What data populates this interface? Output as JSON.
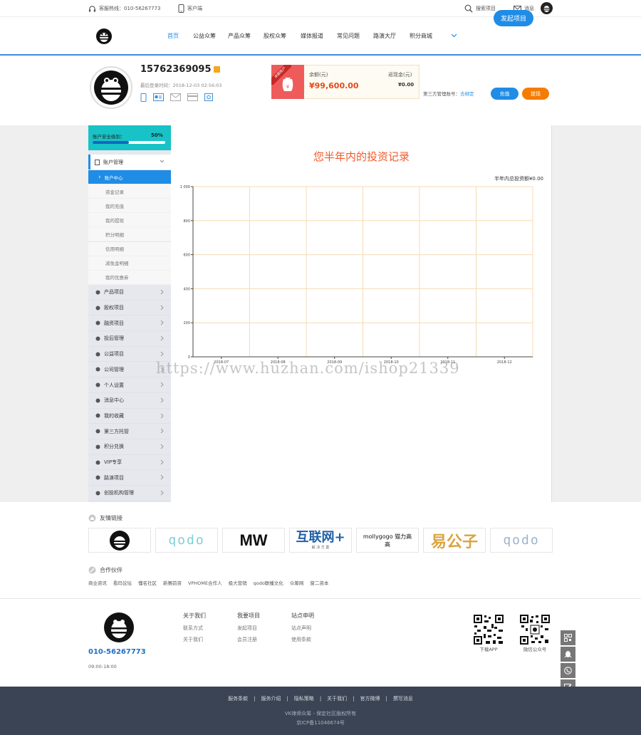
{
  "topbar": {
    "hotline": "客服热线：010-56267773",
    "app": "客户端",
    "search": "搜索项目",
    "message": "消息"
  },
  "nav": {
    "items": [
      "首页",
      "公益众筹",
      "产品众筹",
      "股权众筹",
      "媒体报道",
      "常见问题",
      "路演大厅",
      "积分商城"
    ],
    "launch": "发起项目"
  },
  "profile": {
    "phone": "15762369095",
    "login_time": "最后登录时间：2018-12-03 02:56:03",
    "balance_label": "余额(元)",
    "balance_value": "¥99,600.00",
    "reduce_label": "返现金(元)",
    "reduce_value": "¥0.00",
    "tag": "余额账户",
    "third_label": "第三方管理账号：",
    "third_link": "去绑定",
    "recharge": "充值",
    "withdraw": "提现"
  },
  "security": {
    "label": "账户安全级别：",
    "percent": "50%",
    "level": 0.5
  },
  "sidebar": {
    "head": "账户管理",
    "subs": [
      "账户中心",
      "资金记录",
      "我的充值",
      "我的提现",
      "积分明细",
      "信用明细",
      "减免金明细",
      "我的优惠券"
    ],
    "items": [
      "产品项目",
      "股权项目",
      "融资项目",
      "投后管理",
      "公益项目",
      "公司管理",
      "个人设置",
      "消息中心",
      "我的收藏",
      "第三方托管",
      "积分兑换",
      "VIP专享",
      "路演项目",
      "创投机构管理"
    ]
  },
  "chart": {
    "title": "您半年内的投资记录",
    "total": "半年内总投资额¥0.00"
  },
  "chart_data": {
    "type": "line",
    "categories": [
      "2018-07",
      "2018-08",
      "2018-09",
      "2018-10",
      "2018-11",
      "2018-12"
    ],
    "values": [
      0,
      0,
      0,
      0,
      0,
      0
    ],
    "yticks": [
      0,
      200,
      400,
      600,
      800,
      1000
    ],
    "ytick_labels": [
      "0",
      "200",
      "400",
      "600",
      "800",
      "1 000"
    ],
    "ylim": [
      0,
      1000
    ]
  },
  "watermark": "https://www.huzhan.com/ishop21339",
  "friends": {
    "title": "友情链接",
    "logos": [
      "",
      "qodo",
      "MW",
      "互联网+",
      "mollygogo 猫力高高",
      "易公子",
      "qodo"
    ],
    "hulian_sub": "解 决 方 案"
  },
  "partners": {
    "title": "合作伙伴",
    "items": [
      "商业资讯",
      "看玛论坛",
      "懂名社区",
      "新赛前资",
      "VPHOME合作人",
      "极大营销",
      "qodo联播文化",
      "众筹网",
      "窗二资本"
    ]
  },
  "footer": {
    "phone": "010-56267773",
    "hours": "09:00-18:00",
    "col1": {
      "title": "关于我们",
      "items": [
        "联系方式",
        "关于我们"
      ]
    },
    "col2": {
      "title": "我要项目",
      "items": [
        "发起项目",
        "会员注册"
      ]
    },
    "col3": {
      "title": "站点申明",
      "items": [
        "站点声明",
        "使用条款"
      ]
    },
    "qr1": "下载APP",
    "qr2": "微信公众号"
  },
  "bottom": {
    "links": [
      "服务条款",
      "服务介绍",
      "隐私策略",
      "关于我们",
      "官方微博",
      "撰写消息"
    ],
    "copy1": "VK律师众筹 - 保定社区版权所有",
    "copy2": "京ICP备11046674号"
  }
}
